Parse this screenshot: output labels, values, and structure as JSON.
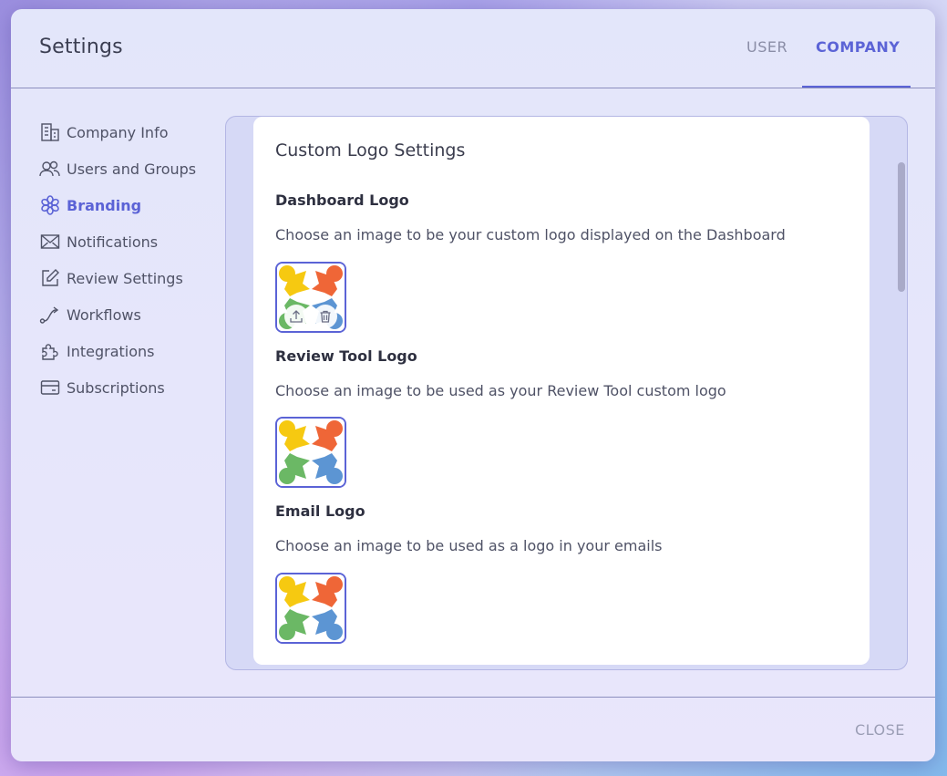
{
  "header": {
    "title": "Settings",
    "tabs": [
      {
        "label": "USER"
      },
      {
        "label": "COMPANY",
        "active": true
      }
    ]
  },
  "sidebar": {
    "items": [
      {
        "label": "Company Info",
        "icon": "building-icon"
      },
      {
        "label": "Users and Groups",
        "icon": "users-icon"
      },
      {
        "label": "Branding",
        "icon": "flower-icon",
        "active": true
      },
      {
        "label": "Notifications",
        "icon": "envelope-icon"
      },
      {
        "label": "Review Settings",
        "icon": "edit-icon"
      },
      {
        "label": "Workflows",
        "icon": "workflow-icon"
      },
      {
        "label": "Integrations",
        "icon": "puzzle-icon"
      },
      {
        "label": "Subscriptions",
        "icon": "card-icon"
      }
    ]
  },
  "main": {
    "title": "Custom Logo Settings",
    "sections": [
      {
        "heading": "Dashboard Logo",
        "description": "Choose an image to be your custom logo displayed on the Dashboard"
      },
      {
        "heading": "Review Tool Logo",
        "description": "Choose an image to be used as your Review Tool custom logo"
      },
      {
        "heading": "Email Logo",
        "description": "Choose an image to be used as a logo in your emails"
      }
    ]
  },
  "footer": {
    "close_label": "CLOSE"
  },
  "colors": {
    "accent": "#5b63d6",
    "logo_yellow": "#f6c911",
    "logo_orange": "#ef6637",
    "logo_green": "#6bb865",
    "logo_blue": "#5c95d3"
  }
}
